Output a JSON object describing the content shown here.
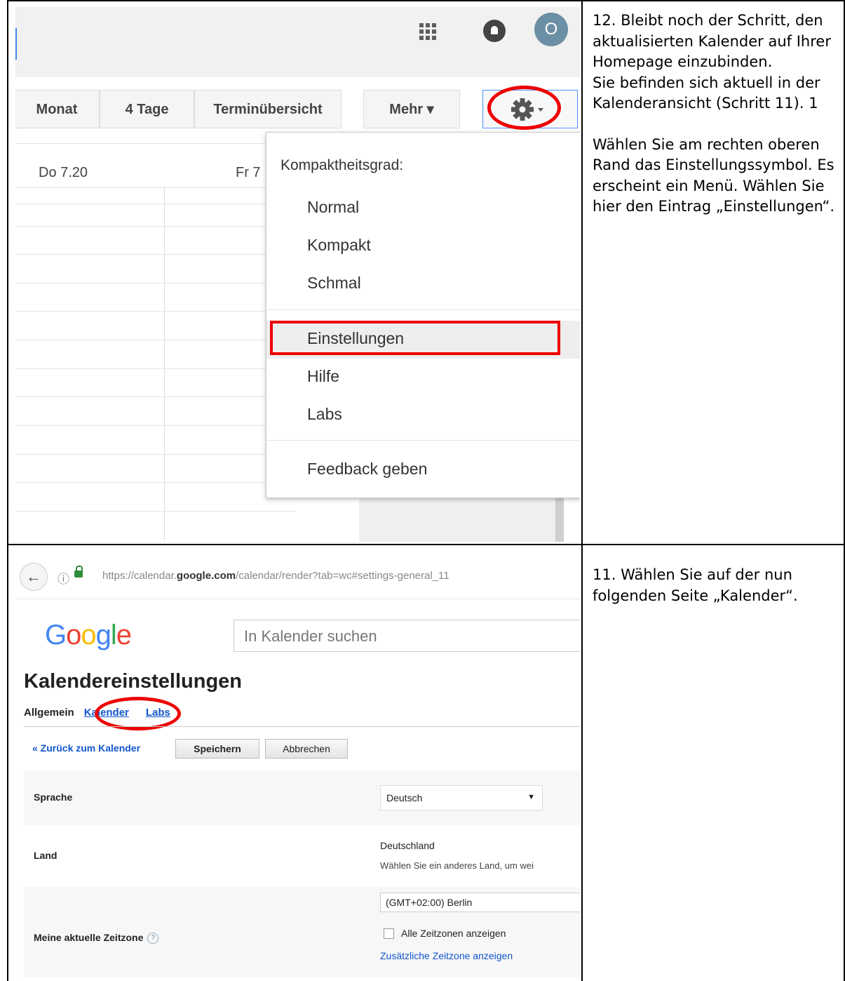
{
  "instructions": {
    "step12": {
      "p1": "12. Bleibt noch der Schritt, den aktualisierten Kalender auf Ihrer Homepage einzubinden.",
      "p2": "Sie befinden sich aktuell in der Kalenderansicht (Schritt 11). 1",
      "p3": "Wählen Sie am rechten oberen Rand das Einstellungssymbol. Es erscheint ein Menü. Wählen Sie hier den Eintrag „Einstellungen“."
    },
    "step11": {
      "p1": "11. Wählen  Sie auf der nun folgenden Seite „Kalender“."
    }
  },
  "calendar": {
    "avatar_initial": "O",
    "toolbar": {
      "month": "Monat",
      "four_days": "4 Tage",
      "agenda": "Terminübersicht",
      "more": "Mehr ▾"
    },
    "day_thu": "Do 7.20",
    "day_fri": "Fr 7",
    "menu": {
      "density_label": "Kompaktheitsgrad:",
      "normal": "Normal",
      "compact": "Kompakt",
      "narrow": "Schmal",
      "settings": "Einstellungen",
      "help": "Hilfe",
      "labs": "Labs",
      "feedback": "Feedback geben"
    }
  },
  "settings_page": {
    "url_prefix": "https://calendar.",
    "url_domain": "google.com",
    "url_suffix": "/calendar/render?tab=wc#settings-general_11",
    "logo": "Google",
    "logo_colors": [
      "#4285f4",
      "#ea4335",
      "#fbbc05",
      "#4285f4",
      "#34a853",
      "#ea4335"
    ],
    "search_placeholder": "In Kalender suchen",
    "title": "Kalendereinstellungen",
    "tabs": {
      "general": "Allgemein",
      "calendars": "Kalender",
      "labs": "Labs"
    },
    "back_link": "« Zurück zum Kalender",
    "save_button": "Speichern",
    "cancel_button": "Abbrechen",
    "language_label": "Sprache",
    "language_value": "Deutsch",
    "country_label": "Land",
    "country_value": "Deutschland",
    "country_hint": "Wählen Sie ein anderes Land, um wei",
    "timezone_label": "Meine aktuelle Zeitzone",
    "timezone_value": "(GMT+02:00) Berlin",
    "all_timezones": "Alle Zeitzonen anzeigen",
    "extra_timezone": "Zusätzliche Zeitzone anzeigen"
  }
}
